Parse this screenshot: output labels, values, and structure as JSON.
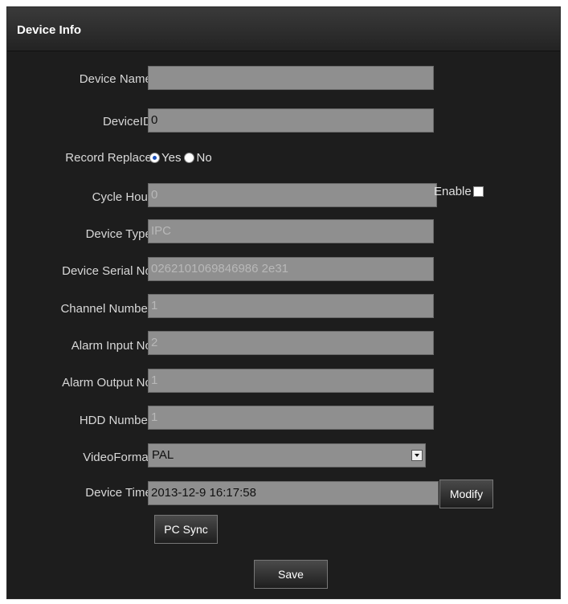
{
  "header": {
    "title": "Device Info"
  },
  "form": {
    "device_name": {
      "label": "Device Name:",
      "value": ""
    },
    "device_id": {
      "label": "DeviceID:",
      "value": "0"
    },
    "record_replace": {
      "label": "Record Replace:",
      "options": [
        {
          "label": "Yes",
          "selected": true
        },
        {
          "label": "No",
          "selected": false
        }
      ]
    },
    "cycle_hour": {
      "label": "Cycle Hour:",
      "value": "0",
      "enable_label": "Enable"
    },
    "device_type": {
      "label": "Device Type:",
      "value": "IPC"
    },
    "serial_no": {
      "label": "Device Serial No:",
      "value": "0262101069846986 2e31"
    },
    "channel_number": {
      "label": "Channel Number:",
      "value": "1"
    },
    "alarm_input": {
      "label": "Alarm Input No:",
      "value": "2"
    },
    "alarm_output": {
      "label": "Alarm Output No:",
      "value": "1"
    },
    "hdd_number": {
      "label": "HDD Number:",
      "value": "1"
    },
    "video_format": {
      "label": "VideoFormat:",
      "selected": "PAL"
    },
    "device_time": {
      "label": "Device Time:",
      "value": "2013-12-9 16:17:58"
    }
  },
  "buttons": {
    "modify": "Modify",
    "pc_sync": "PC Sync",
    "save": "Save"
  }
}
